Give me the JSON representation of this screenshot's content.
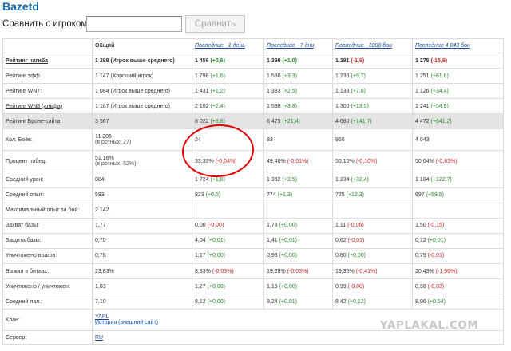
{
  "app": {
    "title": "Bazetd"
  },
  "compare": {
    "label": "Сравнить с игроком",
    "input_value": "",
    "button_label": "Сравнить"
  },
  "table": {
    "headers": [
      "",
      "Общий",
      "Последние ~1 день",
      "Последние ~7 дни",
      "Последние ~1000 бои",
      "Последние 4 043 бои"
    ],
    "rows": [
      {
        "label": "Рейтинг нагиба",
        "label_style": "link-bold",
        "cells": [
          {
            "main": "1 298 (Игрок выше среднего)"
          },
          {
            "main": "1 456",
            "delta": "(+0,6)",
            "sign": "pos"
          },
          {
            "main": "1 390",
            "delta": "(+1,0)",
            "sign": "pos"
          },
          {
            "main": "1 281",
            "delta": "(-1,9)",
            "sign": "neg"
          },
          {
            "main": "1 275",
            "delta": "(-15,9)",
            "sign": "neg"
          }
        ],
        "bold_values": true
      },
      {
        "label": "Рейтинг эфф.",
        "cells": [
          {
            "main": "1 147 (Хороший игрок)"
          },
          {
            "main": "1 798",
            "delta": "(+1,6)",
            "sign": "pos"
          },
          {
            "main": "1 580",
            "delta": "(+3,3)",
            "sign": "pos"
          },
          {
            "main": "1 236",
            "delta": "(+9,7)",
            "sign": "pos"
          },
          {
            "main": "1 251",
            "delta": "(+81,6)",
            "sign": "pos"
          }
        ]
      },
      {
        "label": "Рейтинг WN7:",
        "cells": [
          {
            "main": "1 084 (Игрок выше среднего)"
          },
          {
            "main": "1 431",
            "delta": "(+1,2)",
            "sign": "pos"
          },
          {
            "main": "1 383",
            "delta": "(+2,5)",
            "sign": "pos"
          },
          {
            "main": "1 138",
            "delta": "(+7,8)",
            "sign": "pos"
          },
          {
            "main": "1 126",
            "delta": "(+34,4)",
            "sign": "pos"
          }
        ]
      },
      {
        "label": "Рейтинг WN8 (альфа)",
        "label_style": "link",
        "cells": [
          {
            "main": "1 187 (Игрок выше среднего)"
          },
          {
            "main": "2 102",
            "delta": "(+2,4)",
            "sign": "pos"
          },
          {
            "main": "1 598",
            "delta": "(+3,8)",
            "sign": "pos"
          },
          {
            "main": "1 300",
            "delta": "(+13,5)",
            "sign": "pos"
          },
          {
            "main": "1 241",
            "delta": "(+54,9)",
            "sign": "pos"
          }
        ]
      },
      {
        "label": "Рейтинг Броне-сайта:",
        "shaded": true,
        "cells": [
          {
            "main": "3 567"
          },
          {
            "main": "8 022",
            "delta": "(+8,8)",
            "sign": "pos"
          },
          {
            "main": "6 475",
            "delta": "(+21,4)",
            "sign": "pos"
          },
          {
            "main": "4 680",
            "delta": "(+141,7)",
            "sign": "pos"
          },
          {
            "main": "4 472",
            "delta": "(+641,2)",
            "sign": "pos"
          }
        ]
      },
      {
        "label": "Кол. Боёв:",
        "tall": true,
        "cells": [
          {
            "main": "11 286",
            "sub": "(в ротных: 27)"
          },
          {
            "main": "24"
          },
          {
            "main": "83"
          },
          {
            "main": "956"
          },
          {
            "main": "4 043"
          }
        ]
      },
      {
        "label": "Процент побед:",
        "tall": true,
        "cells": [
          {
            "main": "51,16%",
            "sub": "(в ротных: 52%)"
          },
          {
            "main": "33,33%",
            "delta": "(-0,04%)",
            "sign": "neg"
          },
          {
            "main": "49,40%",
            "delta": "(-0,01%)",
            "sign": "neg"
          },
          {
            "main": "50,10%",
            "delta": "(-0,10%)",
            "sign": "neg"
          },
          {
            "main": "50,04%",
            "delta": "(-0,63%)",
            "sign": "neg"
          }
        ]
      },
      {
        "label": "Средний урон:",
        "cells": [
          {
            "main": "884"
          },
          {
            "main": "1 724",
            "delta": "(+1,8)",
            "sign": "pos"
          },
          {
            "main": "1 362",
            "delta": "(+3,5)",
            "sign": "pos"
          },
          {
            "main": "1 234",
            "delta": "(+32,4)",
            "sign": "pos"
          },
          {
            "main": "1 104",
            "delta": "(+122,7)",
            "sign": "pos"
          }
        ]
      },
      {
        "label": "Средний опыт:",
        "cells": [
          {
            "main": "593"
          },
          {
            "main": "823",
            "delta": "(+0,5)",
            "sign": "pos"
          },
          {
            "main": "774",
            "delta": "(+1,3)",
            "sign": "pos"
          },
          {
            "main": "725",
            "delta": "(+12,3)",
            "sign": "pos"
          },
          {
            "main": "697",
            "delta": "(+58,5)",
            "sign": "pos"
          }
        ]
      },
      {
        "label": "Максимальный опыт за бой:",
        "cells": [
          {
            "main": "2 142"
          },
          {
            "main": ""
          },
          {
            "main": ""
          },
          {
            "main": ""
          },
          {
            "main": ""
          }
        ]
      },
      {
        "label": "Захват базы:",
        "cells": [
          {
            "main": "1,77"
          },
          {
            "main": "0,00",
            "delta": "(-0,00)",
            "sign": "neg"
          },
          {
            "main": "1,78",
            "delta": "(+0,00)",
            "sign": "pos"
          },
          {
            "main": "1,11",
            "delta": "(-0,06)",
            "sign": "neg"
          },
          {
            "main": "1,50",
            "delta": "(-0,15)",
            "sign": "neg"
          }
        ]
      },
      {
        "label": "Защита базы:",
        "cells": [
          {
            "main": "0,70"
          },
          {
            "main": "4,04",
            "delta": "(+0,01)",
            "sign": "pos"
          },
          {
            "main": "1,41",
            "delta": "(+0,01)",
            "sign": "pos"
          },
          {
            "main": "0,62",
            "delta": "(-0,01)",
            "sign": "neg"
          },
          {
            "main": "0,72",
            "delta": "(+0,01)",
            "sign": "pos"
          }
        ]
      },
      {
        "label": "Уничтожено врагов:",
        "cells": [
          {
            "main": "0,78"
          },
          {
            "main": "1,17",
            "delta": "(+0,00)",
            "sign": "pos"
          },
          {
            "main": "0,93",
            "delta": "(+0,00)",
            "sign": "pos"
          },
          {
            "main": "0,80",
            "delta": "(+0,00)",
            "sign": "pos"
          },
          {
            "main": "0,79",
            "delta": "(-0,01)",
            "sign": "neg"
          }
        ]
      },
      {
        "label": "Выжил в битвах:",
        "cells": [
          {
            "main": "23,83%"
          },
          {
            "main": "8,33%",
            "delta": "(-0,03%)",
            "sign": "neg"
          },
          {
            "main": "19,28%",
            "delta": "(-0,03%)",
            "sign": "neg"
          },
          {
            "main": "19,35%",
            "delta": "(-0,41%)",
            "sign": "neg"
          },
          {
            "main": "20,43%",
            "delta": "(-1,96%)",
            "sign": "neg"
          }
        ]
      },
      {
        "label": "Уничтожено / уничтожен:",
        "cells": [
          {
            "main": "1,03"
          },
          {
            "main": "1,27",
            "delta": "(+0,00)",
            "sign": "pos"
          },
          {
            "main": "1,15",
            "delta": "(+0,00)",
            "sign": "pos"
          },
          {
            "main": "0,99",
            "delta": "(-0,00)",
            "sign": "neg"
          },
          {
            "main": "0,98",
            "delta": "(-0,03)",
            "sign": "neg"
          }
        ]
      },
      {
        "label": "Средний лвл.:",
        "cells": [
          {
            "main": "7,10"
          },
          {
            "main": "8,12",
            "delta": "(+0,00)",
            "sign": "pos"
          },
          {
            "main": "8,24",
            "delta": "(+0,01)",
            "sign": "pos"
          },
          {
            "main": "8,42",
            "delta": "(+0,12)",
            "sign": "pos"
          },
          {
            "main": "8,06",
            "delta": "(+0,54)",
            "sign": "pos"
          }
        ]
      }
    ],
    "clan": {
      "label": "Клан:",
      "link1": "YAPL",
      "link2": "История (внешний сайт)"
    },
    "server": {
      "label": "Сервер:",
      "link": "RU"
    }
  },
  "watermark": "YAPLAKAL.COM",
  "colors": {
    "positive": "#2a8a2a",
    "negative": "#c82828",
    "link": "#1a4a9a",
    "title": "#1a6aa8",
    "annotation": "#e00000"
  }
}
